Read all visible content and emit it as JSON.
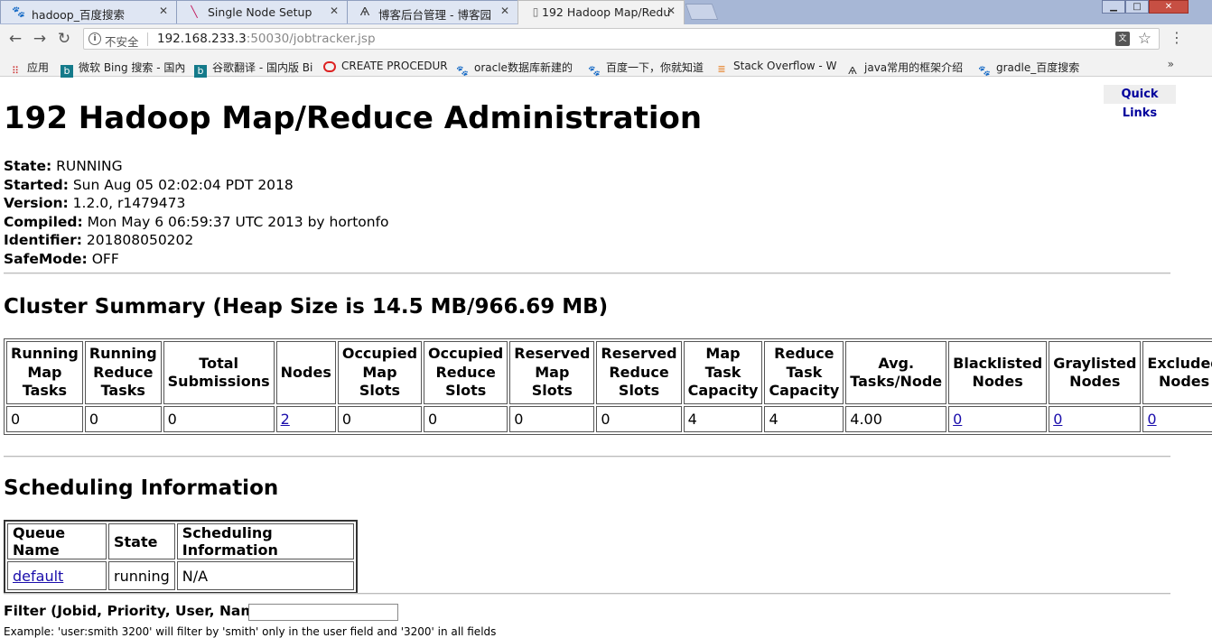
{
  "browser": {
    "tabs": [
      {
        "label": "hadoop_百度搜索",
        "icon": "paw-icon"
      },
      {
        "label": "Single Node Setup",
        "icon": "feather-icon"
      },
      {
        "label": "博客后台管理 - 博客园",
        "icon": "cnblogs-icon"
      },
      {
        "label": "192 Hadoop Map/Redu",
        "icon": "page-icon"
      }
    ],
    "security_label": "不安全",
    "url_host": "192.168.233.3",
    "url_rest": ":50030/jobtracker.jsp",
    "bookmarks": [
      {
        "label": "应用",
        "icon": "apps-icon"
      },
      {
        "label": "微软 Bing 搜索 - 国內",
        "icon": "bing-icon"
      },
      {
        "label": "谷歌翻译 - 国内版 Bi",
        "icon": "bing-icon"
      },
      {
        "label": "CREATE PROCEDUR",
        "icon": "oracle-icon"
      },
      {
        "label": "oracle数据库新建的",
        "icon": "paw-icon"
      },
      {
        "label": "百度一下，你就知道",
        "icon": "paw-icon"
      },
      {
        "label": "Stack Overflow - W",
        "icon": "stackoverflow-icon"
      },
      {
        "label": "java常用的框架介绍",
        "icon": "cnblogs-icon"
      },
      {
        "label": "gradle_百度搜索",
        "icon": "paw-icon"
      }
    ],
    "bookmarks_more": "»"
  },
  "page": {
    "quick_links": "Quick Links",
    "title": "192 Hadoop Map/Reduce Administration",
    "info": [
      {
        "label": "State:",
        "value": "RUNNING"
      },
      {
        "label": "Started:",
        "value": "Sun Aug 05 02:02:04 PDT 2018"
      },
      {
        "label": "Version:",
        "value": "1.2.0, r1479473"
      },
      {
        "label": "Compiled:",
        "value": "Mon May 6 06:59:37 UTC 2013 by hortonfo"
      },
      {
        "label": "Identifier:",
        "value": "201808050202"
      },
      {
        "label": "SafeMode:",
        "value": "OFF"
      }
    ],
    "cluster_summary_heading": "Cluster Summary (Heap Size is 14.5 MB/966.69 MB)",
    "summary": {
      "headers": [
        "Running Map Tasks",
        "Running Reduce Tasks",
        "Total Submissions",
        "Nodes",
        "Occupied Map Slots",
        "Occupied Reduce Slots",
        "Reserved Map Slots",
        "Reserved Reduce Slots",
        "Map Task Capacity",
        "Reduce Task Capacity",
        "Avg. Tasks/Node",
        "Blacklisted Nodes",
        "Graylisted Nodes",
        "Excluded Nodes"
      ],
      "values": [
        "0",
        "0",
        "0",
        "2",
        "0",
        "0",
        "0",
        "0",
        "4",
        "4",
        "4.00",
        "0",
        "0",
        "0"
      ]
    },
    "scheduling_heading": "Scheduling Information",
    "scheduling": {
      "headers": [
        "Queue Name",
        "State",
        "Scheduling Information"
      ],
      "rows": [
        [
          "default",
          "running",
          "N/A"
        ]
      ]
    },
    "filter_label": "Filter (Jobid, Priority, User, Name)",
    "filter_example": "Example: 'user:smith 3200' will filter by 'smith' only in the user field and '3200' in all fields"
  }
}
